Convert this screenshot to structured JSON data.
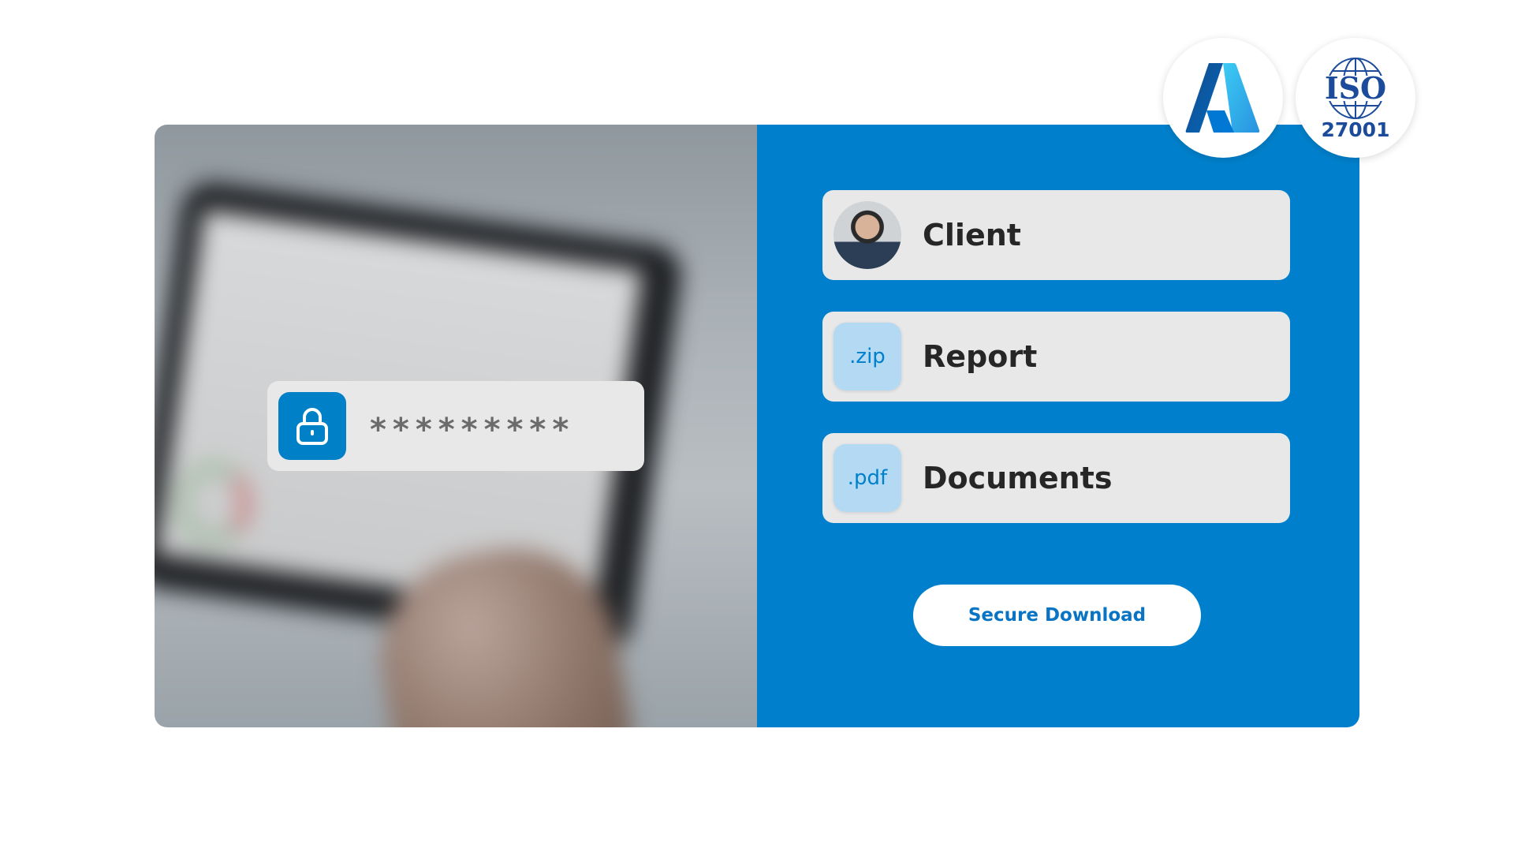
{
  "password_field": {
    "masked_value": "*********",
    "icon": "lock-icon"
  },
  "items": [
    {
      "label": "Client",
      "icon": "client-avatar"
    },
    {
      "label": "Report",
      "icon_text": ".zip"
    },
    {
      "label": "Documents",
      "icon_text": ".pdf"
    }
  ],
  "button": {
    "label": "Secure Download"
  },
  "badges": {
    "azure": "A",
    "iso_logo": "ISO",
    "iso_number": "27001"
  },
  "colors": {
    "brand_blue": "#0080cc",
    "row_bg": "#e8e8e8",
    "file_icon_bg": "#b3daf2"
  }
}
